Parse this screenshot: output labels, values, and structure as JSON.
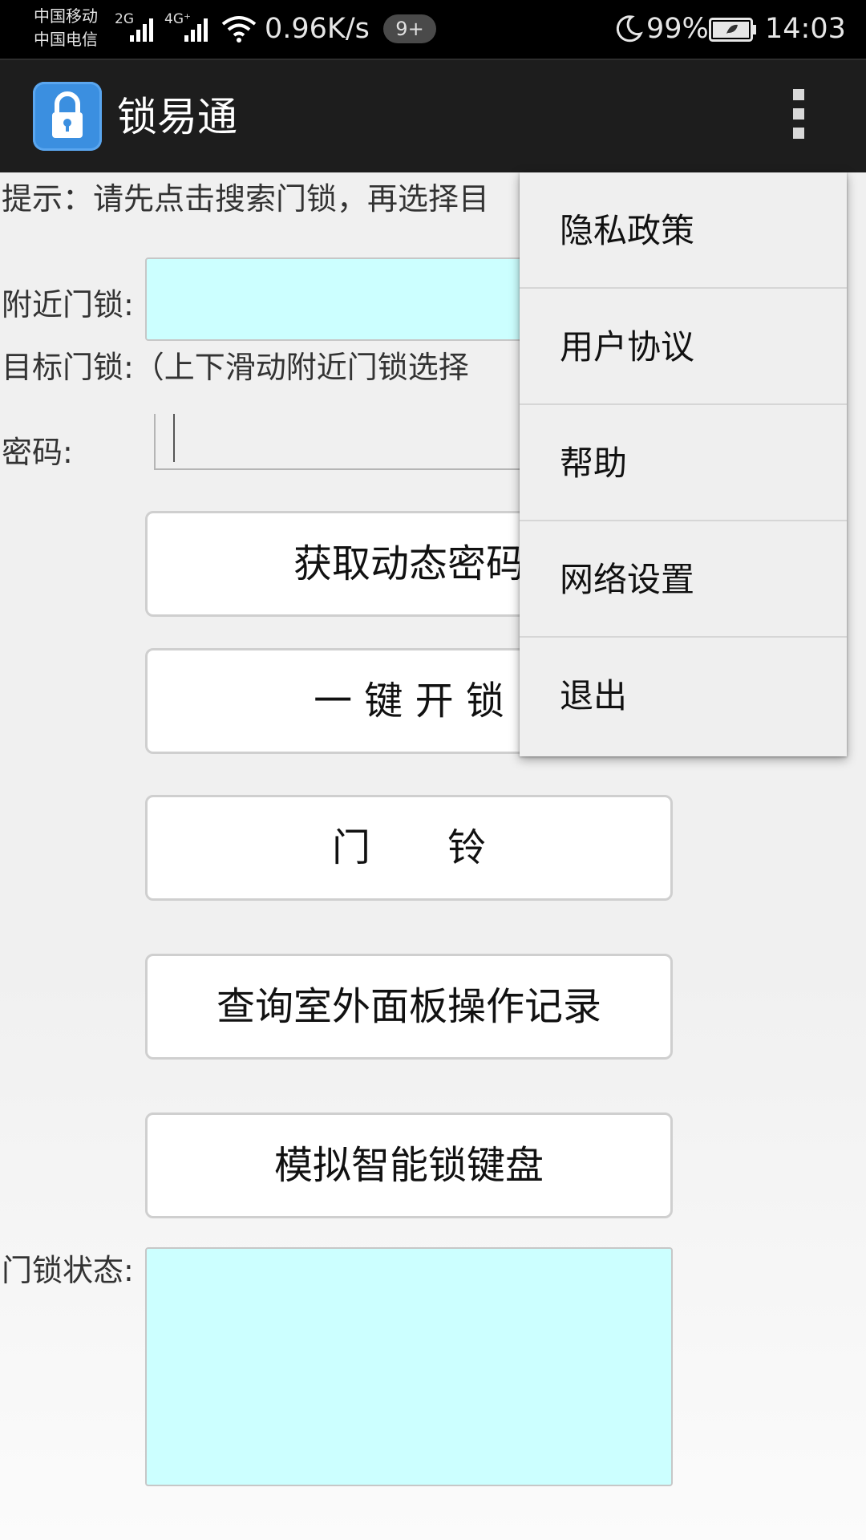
{
  "status_bar": {
    "carrier_1": "中国移动",
    "carrier_2": "中国电信",
    "net_1": "2G",
    "net_2": "4G⁺",
    "speed": "0.96K/s",
    "notif_badge": "9+",
    "battery": "99%",
    "time": "14:03"
  },
  "app_bar": {
    "title": "锁易通",
    "icon": "padlock-app-icon",
    "overflow_icon": "more-vertical-icon"
  },
  "form": {
    "hint": "提示：请先点击搜索门锁，再选择目",
    "nearby_label": "附近门锁:",
    "target_label": "目标门锁:（上下滑动附近门锁选择",
    "password_label": "密码:",
    "password_value": "",
    "status_label": "门锁状态:",
    "status_value": ""
  },
  "buttons": {
    "get_dynamic_password": "获取动态密码",
    "one_key_unlock": "一 键 开 锁",
    "doorbell": "门　　铃",
    "query_records": "查询室外面板操作记录",
    "simulate_keyboard": "模拟智能锁键盘"
  },
  "menu": {
    "items": [
      {
        "label": "隐私政策"
      },
      {
        "label": "用户协议"
      },
      {
        "label": "帮助"
      },
      {
        "label": "网络设置"
      },
      {
        "label": "退出"
      }
    ]
  },
  "colors": {
    "field_bg": "#ccffff",
    "app_icon_bg": "#3b8fe0",
    "action_bar": "#1d1d1d"
  }
}
